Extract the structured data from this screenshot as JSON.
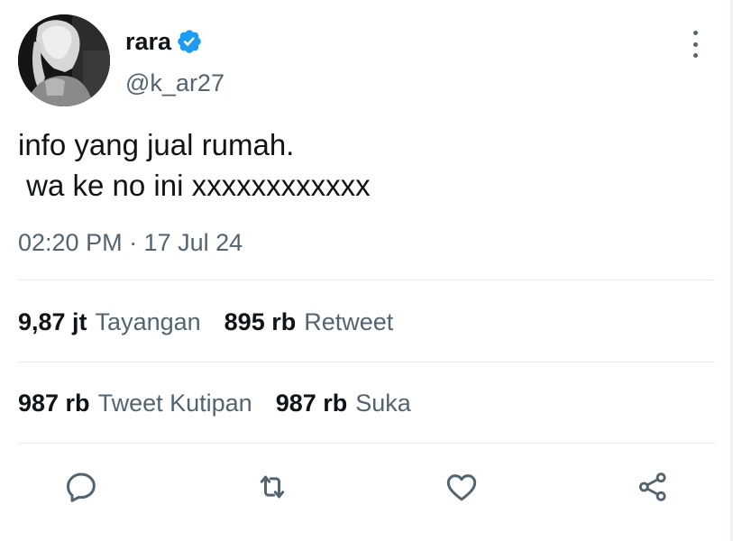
{
  "user": {
    "display_name": "rara",
    "handle": "@k_ar27",
    "verified": true,
    "verified_color": "#1d9bf0",
    "avatar_icon": "profile-photo"
  },
  "tweet": {
    "text_lines": [
      "info yang jual rumah.",
      " wa ke no ini xxxxxxxxxxxx"
    ],
    "timestamp": "02:20 PM · 17 Jul 24"
  },
  "stats": {
    "views": {
      "value": "9,87 jt",
      "label": "Tayangan"
    },
    "retweets": {
      "value": "895 rb",
      "label": "Retweet"
    },
    "quotes": {
      "value": "987 rb",
      "label": "Tweet Kutipan"
    },
    "likes": {
      "value": "987 rb",
      "label": "Suka"
    }
  },
  "actions": [
    "reply-icon",
    "retweet-icon",
    "like-icon",
    "share-icon"
  ],
  "colors": {
    "text_primary": "#0f1419",
    "text_secondary": "#536471",
    "divider": "#e6ecf0",
    "action_icon": "#536471"
  }
}
